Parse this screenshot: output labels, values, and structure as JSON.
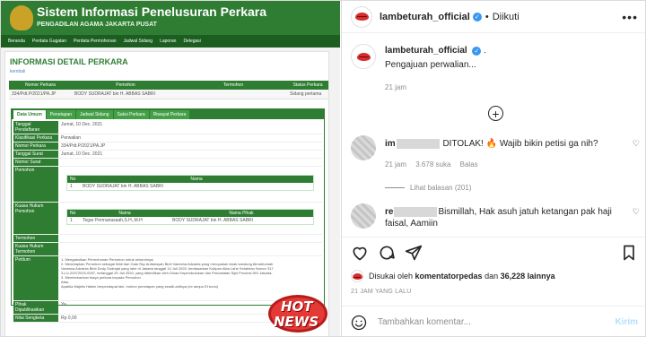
{
  "sipp": {
    "title": "Sistem Informasi Penelusuran Perkara",
    "subtitle": "PENGADILAN AGAMA JAKARTA PUSAT",
    "nav": [
      "Beranda",
      "Perdata Gugatan",
      "Perdata Permohonan",
      "Jadwal Sidang",
      "Laporan",
      "Delegasi"
    ],
    "section_title": "INFORMASI DETAIL PERKARA",
    "back_link": "kembali",
    "head_cols": [
      "Nomor Perkara",
      "Pemohon",
      "Termohon",
      "Status Perkara"
    ],
    "head_values": [
      "334/Pdt.P/2021/PA.JP",
      "BODY SUDRAJAT bin H. ABBAS SABRI",
      "",
      "Sidang pertama"
    ],
    "tabs": [
      "Data Umum",
      "Penetapan",
      "Jadwal Sidang",
      "Saksi Perkara",
      "Riwayat Perkara"
    ],
    "rows": [
      {
        "k": "Tanggal Pendaftaran",
        "v": "Jumat, 10 Dec. 2021"
      },
      {
        "k": "Klasifikasi Perkara",
        "v": "Perwalian"
      },
      {
        "k": "Nomor Perkara",
        "v": "334/Pdt.P/2021/PA.JP"
      },
      {
        "k": "Tanggal Surat",
        "v": "Jumat, 10 Dec. 2021"
      },
      {
        "k": "Nomor Surat",
        "v": ""
      },
      {
        "k": "Pemohon",
        "v": ""
      }
    ],
    "pemohon_table": {
      "cols": [
        "No",
        "Nama"
      ],
      "row": [
        "1",
        "BODY SUDRAJAT bin H. ABBAS SABRI"
      ]
    },
    "kuasa_label": "Kuasa Hukum Pemohon",
    "kuasa_table": {
      "cols": [
        "No",
        "Nama",
        "Nama Pihak"
      ],
      "row": [
        "1",
        "Tegar Permanasaah,S.H.,M.H",
        "BODY SUDRAJAT bin H. ABBAS SABRI"
      ]
    },
    "rows2": [
      {
        "k": "Termohon",
        "v": ""
      },
      {
        "k": "Kuasa Hukum Termohon",
        "v": ""
      },
      {
        "k": "Petitum",
        "v": "1.    Mengabulkan Permohonan Pemohon untuk seluruhnya;"
      }
    ],
    "petitum_lines": [
      "2.    Menetapkan Pemohon sebagai Wali dari Gala Sky Ardiansyah Binti Vanesha Adzania yang merupakan Anak kandung Almarhumah",
      "Vanessa Adzania Binti Dody Sudrajat yang lahir di Jakarta tanggal 14 Juli 2020, berdasarkan Kutipan Akta Lahir Kelahiran Nomor 317",
      "3-LU-20072020-0097, tertanggal 25 Juli 2020, yang diterbitkan oleh Dinas Kependudukan dan Pencatatan Sipil Provinsi DKI Jakarta;",
      "3.    Membebankan biaya perkara kepada Pemohon",
      "Atau,",
      "Apabila Majelis Hakim berpendapat lain, mohon penetapan yang seadil-adilnya (ex aequo Et bono)"
    ],
    "rows3": [
      {
        "k": "Pihak Dipublikasikan",
        "v": "Ya"
      },
      {
        "k": "Nilai Sengketa",
        "v": "Rp 0,00"
      }
    ],
    "badge_line1": "HOT",
    "badge_line2": "NEWS"
  },
  "ig": {
    "username": "lambeturah_official",
    "dot": "•",
    "follow_status": "Diikuti",
    "caption_text": "Pengajuan perwalian...",
    "caption_tail": ".",
    "caption_time": "21 jam",
    "comments": [
      {
        "user_visible": "im",
        "text": "DITOLAK! 🔥 Wajib bikin petisi ga nih?",
        "time": "21 jam",
        "likes": "3.678 suka",
        "reply": "Balas"
      },
      {
        "user_visible": "re",
        "text": "Bismillah, Hak asuh jatuh ketangan pak haji faisal, Aamiin"
      }
    ],
    "view_replies": "Lihat balasan (201)",
    "liked_by_prefix": "Disukai oleh",
    "liked_by_user": "komentatorpedas",
    "liked_by_and": "dan",
    "liked_by_count": "36,228 lainnya",
    "post_date": "21 JAM YANG LALU",
    "comment_placeholder": "Tambahkan komentar...",
    "send_label": "Kirim",
    "icons": [
      "heart-icon",
      "comment-icon",
      "share-icon",
      "bookmark-icon",
      "emoji-icon",
      "more-icon",
      "verified-icon",
      "plus-circle-icon"
    ],
    "accent_color": "#3897f0"
  }
}
